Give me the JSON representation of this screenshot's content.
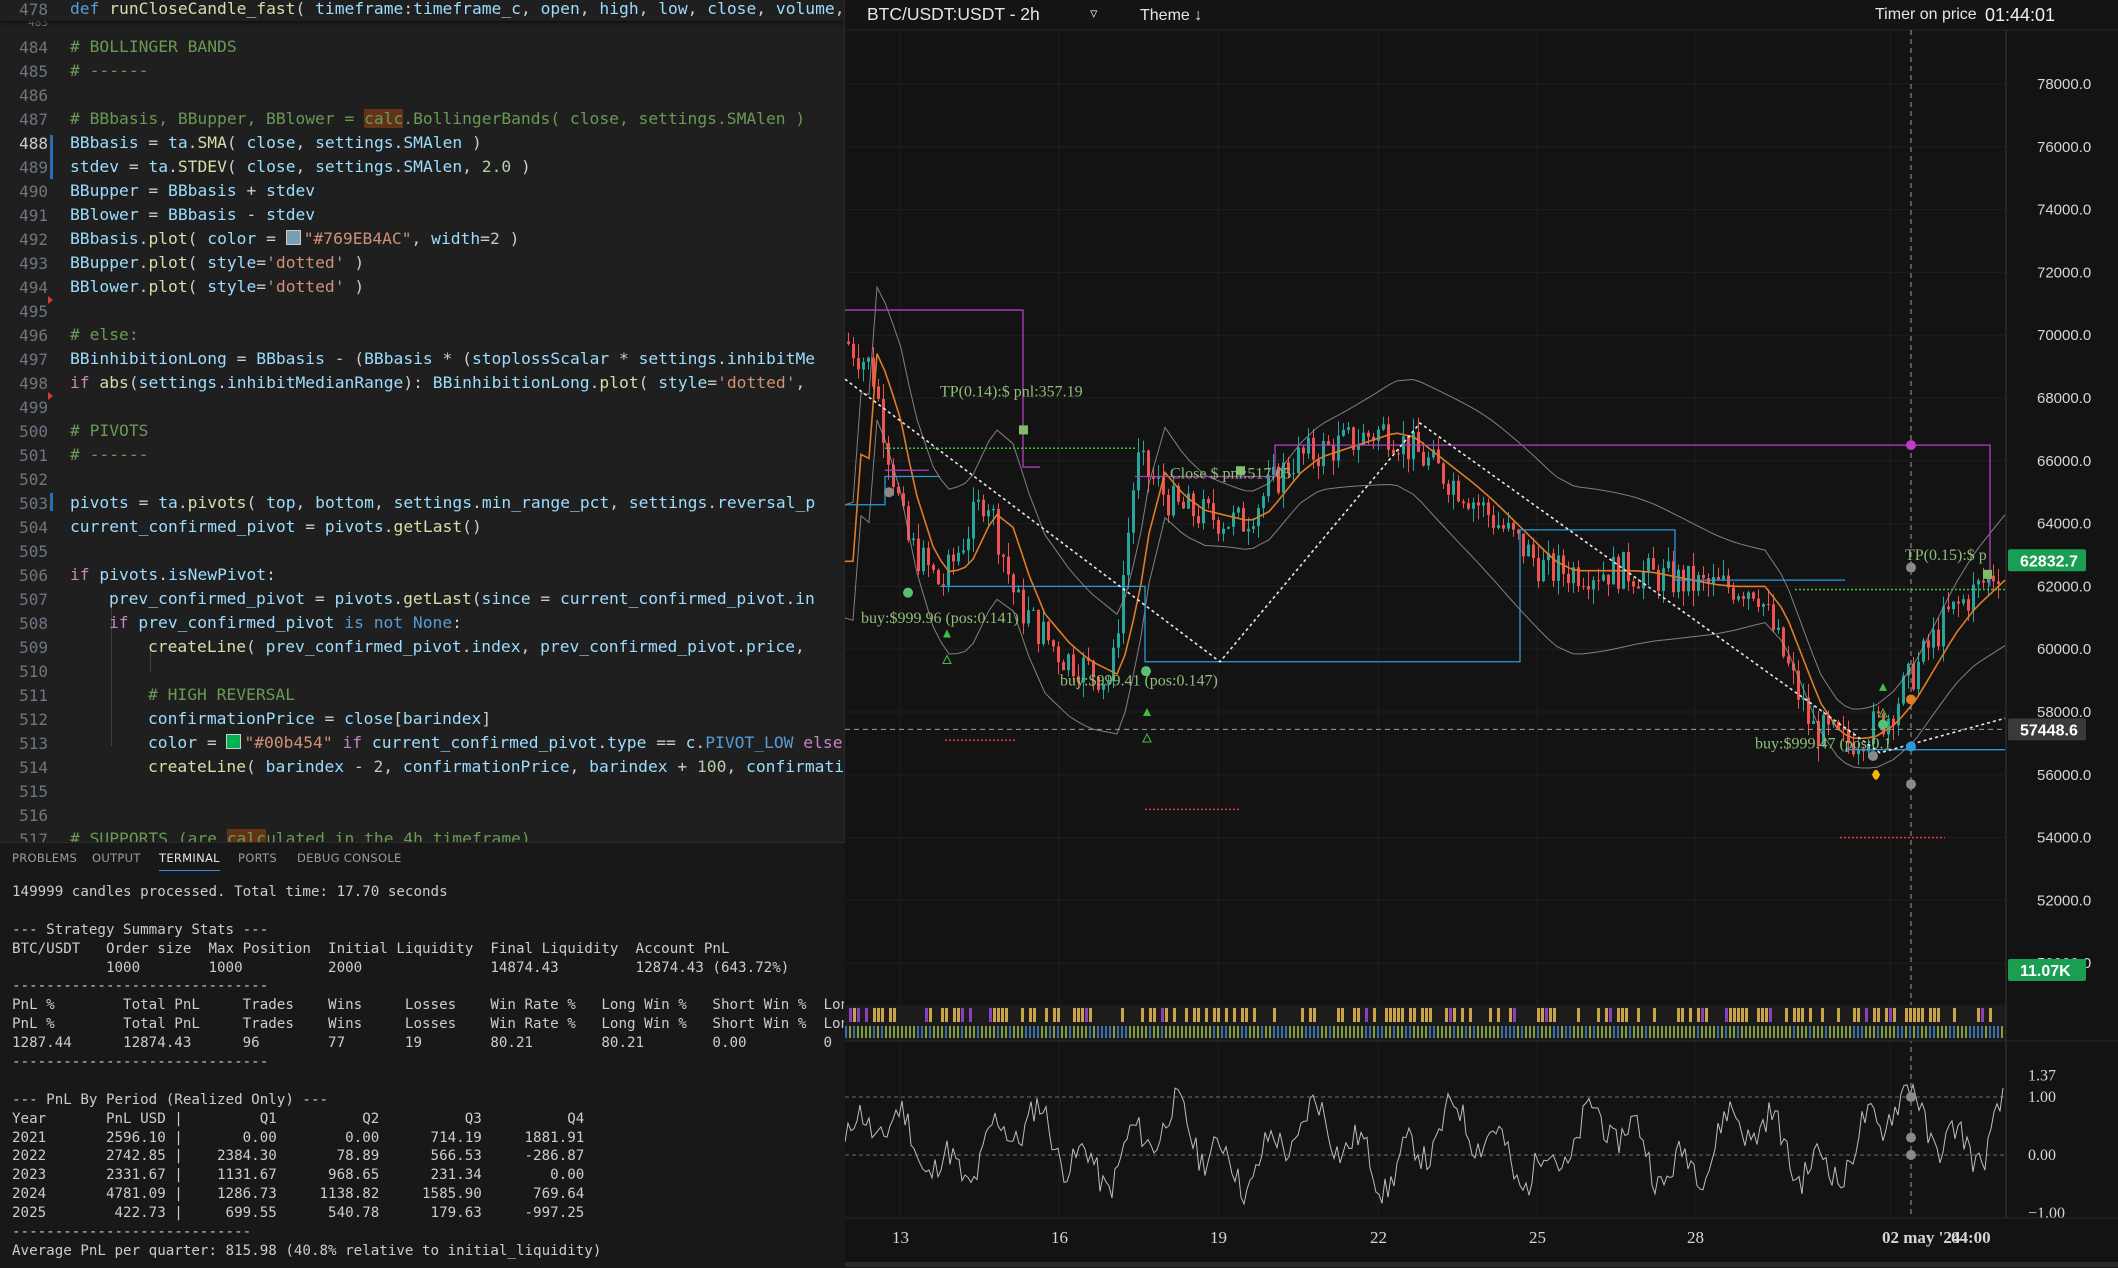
{
  "editor": {
    "sticky": {
      "line": "478",
      "kw": "def",
      "fn": "runCloseCandle_fast",
      "rest_a": "( ",
      "p1": "timeframe",
      "colon": ":",
      "t1": "timeframe_c",
      "rest_b": ", ",
      "p2": "open",
      "c2": ", ",
      "p3": "high",
      "c3": ", ",
      "p4": "low",
      "c4": ", ",
      "p5": "close",
      "c5": ", ",
      "p6": "volume",
      "c6": ","
    },
    "partial_line": "483",
    "active_line": "488",
    "lines": [
      {
        "n": "484"
      },
      {
        "n": "485"
      },
      {
        "n": "486"
      },
      {
        "n": "487"
      },
      {
        "n": "488"
      },
      {
        "n": "489"
      },
      {
        "n": "490"
      },
      {
        "n": "491"
      },
      {
        "n": "492"
      },
      {
        "n": "493"
      },
      {
        "n": "494"
      },
      {
        "n": "495"
      },
      {
        "n": "496"
      },
      {
        "n": "497"
      },
      {
        "n": "498"
      },
      {
        "n": "499"
      },
      {
        "n": "500"
      },
      {
        "n": "501"
      },
      {
        "n": "502"
      },
      {
        "n": "503"
      },
      {
        "n": "504"
      },
      {
        "n": "505"
      },
      {
        "n": "506"
      },
      {
        "n": "507"
      },
      {
        "n": "508"
      },
      {
        "n": "509"
      },
      {
        "n": "510"
      },
      {
        "n": "511"
      },
      {
        "n": "512"
      },
      {
        "n": "513"
      },
      {
        "n": "514"
      },
      {
        "n": "515"
      },
      {
        "n": "516"
      },
      {
        "n": "517"
      }
    ],
    "code": {
      "l484": "# BOLLINGER BANDS",
      "l485": "# ------",
      "l487_a": "# BBbasis, BBupper, BBlower = ",
      "l487_hl": "calc",
      "l487_b": ".BollingerBands( close, settings.SMAlen )",
      "l488_a": "BBbasis",
      "l488_b": " = ",
      "l488_c": "ta",
      "l488_d": ".",
      "l488_e": "SMA",
      "l488_f": "( ",
      "l488_g": "close",
      "l488_h": ", ",
      "l488_i": "settings",
      "l488_j": ".",
      "l488_k": "SMAlen",
      "l488_l": " )",
      "l489_a": "stdev",
      "l489_b": " = ",
      "l489_c": "ta",
      "l489_d": ".",
      "l489_e": "STDEV",
      "l489_f": "( ",
      "l489_g": "close",
      "l489_h": ", ",
      "l489_i": "settings",
      "l489_j": ".",
      "l489_k": "SMAlen",
      "l489_l": ", ",
      "l489_m": "2.0",
      "l489_n": " )",
      "l490_a": "BBupper",
      "l490_b": " = ",
      "l490_c": "BBbasis",
      "l490_d": " + ",
      "l490_e": "stdev",
      "l491_a": "BBlower",
      "l491_b": " = ",
      "l491_c": "BBbasis",
      "l491_d": " - ",
      "l491_e": "stdev",
      "l492_a": "BBbasis",
      "l492_b": ".",
      "l492_c": "plot",
      "l492_d": "( ",
      "l492_e": "color",
      "l492_f": " = ",
      "l492_g": "\"#769EB4AC\"",
      "l492_h": ", ",
      "l492_i": "width",
      "l492_j": "=",
      "l492_k": "2",
      "l492_l": " )",
      "l493_a": "BBupper",
      "l493_b": ".",
      "l493_c": "plot",
      "l493_d": "( ",
      "l493_e": "style",
      "l493_f": "=",
      "l493_g": "'dotted'",
      "l493_h": " )",
      "l494_a": "BBlower",
      "l494_b": ".",
      "l494_c": "plot",
      "l494_d": "( ",
      "l494_e": "style",
      "l494_f": "=",
      "l494_g": "'dotted'",
      "l494_h": " )",
      "l496": "# else:",
      "l497_a": "BBinhibitionLong",
      "l497_b": " = ",
      "l497_c": "BBbasis",
      "l497_d": " - (",
      "l497_e": "BBbasis",
      "l497_f": " * (",
      "l497_g": "stoplossScalar",
      "l497_h": " * ",
      "l497_i": "settings",
      "l497_j": ".",
      "l497_k": "inhibitMe",
      "l498_a": "if",
      "l498_b": " ",
      "l498_c": "abs",
      "l498_d": "(",
      "l498_e": "settings",
      "l498_f": ".",
      "l498_g": "inhibitMedianRange",
      "l498_h": "): ",
      "l498_i": "BBinhibitionLong",
      "l498_j": ".",
      "l498_k": "plot",
      "l498_l": "( ",
      "l498_m": "style",
      "l498_n": "=",
      "l498_o": "'dotted'",
      "l498_p": ",",
      "l500": "# PIVOTS",
      "l501": "# ------",
      "l503_a": "pivots",
      "l503_b": " = ",
      "l503_c": "ta",
      "l503_d": ".",
      "l503_e": "pivots",
      "l503_f": "( ",
      "l503_g": "top",
      "l503_h": ", ",
      "l503_i": "bottom",
      "l503_j": ", ",
      "l503_k": "settings",
      "l503_l": ".",
      "l503_m": "min_range_pct",
      "l503_n": ", ",
      "l503_o": "settings",
      "l503_p": ".",
      "l503_q": "reversal_p",
      "l504_a": "current_confirmed_pivot",
      "l504_b": " = ",
      "l504_c": "pivots",
      "l504_d": ".",
      "l504_e": "getLast",
      "l504_f": "()",
      "l506_a": "if",
      "l506_b": " ",
      "l506_c": "pivots",
      "l506_d": ".",
      "l506_e": "isNewPivot",
      "l506_f": ":",
      "l507_a": "prev_confirmed_pivot",
      "l507_b": " = ",
      "l507_c": "pivots",
      "l507_d": ".",
      "l507_e": "getLast",
      "l507_f": "(",
      "l507_g": "since",
      "l507_h": " = ",
      "l507_i": "current_confirmed_pivot",
      "l507_j": ".",
      "l507_k": "in",
      "l508_a": "if",
      "l508_b": " ",
      "l508_c": "prev_confirmed_pivot",
      "l508_d": " ",
      "l508_e": "is not",
      "l508_f": " ",
      "l508_g": "None",
      "l508_h": ":",
      "l509_a": "createLine",
      "l509_b": "( ",
      "l509_c": "prev_confirmed_pivot",
      "l509_d": ".",
      "l509_e": "index",
      "l509_f": ", ",
      "l509_g": "prev_confirmed_pivot",
      "l509_h": ".",
      "l509_i": "price",
      "l509_j": ",",
      "l511": "# HIGH REVERSAL",
      "l512_a": "confirmationPrice",
      "l512_b": " = ",
      "l512_c": "close",
      "l512_d": "[",
      "l512_e": "barindex",
      "l512_f": "]",
      "l513_a": "color",
      "l513_b": " = ",
      "l513_c": "\"#00b454\"",
      "l513_d": " ",
      "l513_e": "if",
      "l513_f": " ",
      "l513_g": "current_confirmed_pivot",
      "l513_h": ".",
      "l513_i": "type",
      "l513_j": " == ",
      "l513_k": "c",
      "l513_l": ".",
      "l513_m": "PIVOT_LOW",
      "l513_n": " ",
      "l513_o": "else",
      "l514_a": "createLine",
      "l514_b": "( ",
      "l514_c": "barindex",
      "l514_d": " - ",
      "l514_e": "2",
      "l514_f": ", ",
      "l514_g": "confirmationPrice",
      "l514_h": ", ",
      "l514_i": "barindex",
      "l514_j": " + ",
      "l514_k": "100",
      "l514_l": ", ",
      "l514_m": "confirmatio",
      "l517_a": "# SUPPORTS (are ",
      "l517_hl": "calc",
      "l517_b": "ulated in the 4h timeframe)"
    }
  },
  "panel": {
    "tabs": [
      "PROBLEMS",
      "OUTPUT",
      "TERMINAL",
      "PORTS",
      "DEBUG CONSOLE"
    ],
    "active_tab": "TERMINAL",
    "terminal_lines": [
      "149999 candles processed. Total time: 17.70 seconds",
      "",
      "--- Strategy Summary Stats ---",
      "BTC/USDT   Order size  Max Position  Initial Liquidity  Final Liquidity  Account PnL",
      "           1000        1000          2000               14874.43         12874.43 (643.72%)",
      "------------------------------",
      "PnL %        Total PnL     Trades    Wins     Losses    Win Rate %   Long Win %   Short Win %  Long SL",
      "PnL %        Total PnL     Trades    Wins     Losses    Win Rate %   Long Win %   Short Win %  Long SL",
      "1287.44      12874.43      96        77       19        80.21        80.21        0.00         0",
      "------------------------------",
      "",
      "--- PnL By Period (Realized Only) ---",
      "Year       PnL USD |         Q1          Q2          Q3          Q4",
      "2021       2596.10 |       0.00        0.00      714.19     1881.91",
      "2022       2742.85 |    2384.30       78.89      566.53     -286.87",
      "2023       2331.67 |    1131.67      968.65      231.34        0.00",
      "2024       4781.09 |    1286.73     1138.82     1585.90      769.64",
      "2025        422.73 |     699.55      540.78      179.63     -997.25",
      "----------------------------",
      "Average PnL per quarter: 815.98 (40.8% relative to initial_liquidity)"
    ]
  },
  "chart": {
    "symbol": "BTC/USDT:USDT - 2h",
    "filter_icon": "▿",
    "theme_label": "Theme ↓",
    "timer_label": "Timer on price",
    "clock": "01:44:01",
    "price_badge": "62832.7",
    "crosshair_badge": "57448.6",
    "volume_badge": "11.07K",
    "price_ticks": [
      "78000.0",
      "76000.0",
      "74000.0",
      "72000.0",
      "70000.0",
      "68000.0",
      "66000.0",
      "64000.0",
      "62000.0",
      "60000.0",
      "58000.0",
      "56000.0",
      "54000.0",
      "52000.0",
      "50000.0"
    ],
    "osc_ticks": [
      "1.37",
      "1.00",
      "0.00",
      "−1.00"
    ],
    "time_ticks": [
      "13",
      "16",
      "19",
      "22",
      "25",
      "28",
      "02 may '24",
      "04:00"
    ],
    "annotations": {
      "tp1": "TP(0.14):$ pnl:357.19",
      "close1": "Close $ pnl:517.05",
      "buy1": "buy:$999.96 (pos:0.141)",
      "buy2": "buy:$999.41 (pos:0.147)",
      "buy3": "buy:$999.47 (pos:0.1",
      "tp2": "TP(0.15):$ p"
    },
    "colors": {
      "up": "#26a69a",
      "down": "#ef5350",
      "bb_basis": "#e07b28",
      "bb_band": "#9e9e9e",
      "magenta": "#b33fbf",
      "blue": "#2b9ad6",
      "green_dotted": "#3ec43e",
      "red_dotted": "#d63c3c",
      "badge_green": "#1a9e52"
    }
  }
}
